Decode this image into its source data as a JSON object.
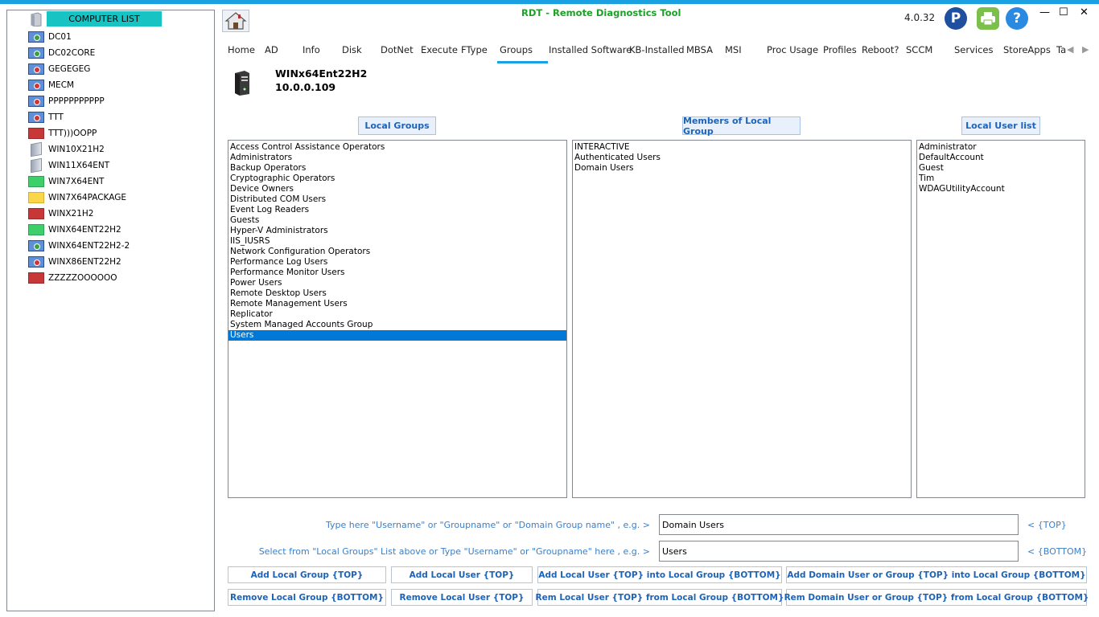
{
  "app": {
    "title": "RDT - Remote Diagnostics Tool",
    "version": "4.0.32",
    "minimize": "—",
    "maximize": "☐",
    "close": "✕",
    "paypal": "P",
    "help": "?"
  },
  "computer_list": {
    "header": "COMPUTER LIST",
    "items": [
      {
        "name": "DC01",
        "icon": "monitor-green"
      },
      {
        "name": "DC02CORE",
        "icon": "monitor-green"
      },
      {
        "name": "GEGEGEG",
        "icon": "monitor-red"
      },
      {
        "name": "MECM",
        "icon": "monitor-red"
      },
      {
        "name": "PPPPPPPPPPP",
        "icon": "monitor-red"
      },
      {
        "name": "TTT",
        "icon": "monitor-red"
      },
      {
        "name": "TTT)))OOPP",
        "icon": "square-red"
      },
      {
        "name": "WIN10X21H2",
        "icon": "tower"
      },
      {
        "name": "WIN11X64ENT",
        "icon": "tower"
      },
      {
        "name": "WIN7X64ENT",
        "icon": "square-green"
      },
      {
        "name": "WIN7X64PACKAGE",
        "icon": "square-yellow"
      },
      {
        "name": "WINX21H2",
        "icon": "square-red"
      },
      {
        "name": "WINX64ENT22H2",
        "icon": "square-green"
      },
      {
        "name": "WINX64ENT22H2-2",
        "icon": "monitor-green"
      },
      {
        "name": "WINX86ENT22H2",
        "icon": "monitor-red"
      },
      {
        "name": "ZZZZZOOOOOO",
        "icon": "square-red"
      }
    ]
  },
  "tabs": [
    "Home",
    "AD",
    "Info",
    "Disk",
    "DotNet",
    "Execute",
    "FType",
    "Groups",
    "Installed Software",
    "KB-Installed",
    "MBSA",
    "MSI",
    "Proc Usage",
    "Profiles",
    "Reboot?",
    "SCCM",
    "Services",
    "StoreApps",
    "Ta"
  ],
  "active_tab": "Groups",
  "host": {
    "name": "WINx64Ent22H2",
    "ip": "10.0.0.109"
  },
  "columns": {
    "local_groups_label": "Local Groups",
    "members_label": "Members of Local Group",
    "local_users_label": "Local User list"
  },
  "local_groups": [
    "Access Control Assistance Operators",
    "Administrators",
    "Backup Operators",
    "Cryptographic Operators",
    "Device Owners",
    "Distributed COM Users",
    "Event Log Readers",
    "Guests",
    "Hyper-V Administrators",
    "IIS_IUSRS",
    "Network Configuration Operators",
    "Performance Log Users",
    "Performance Monitor Users",
    "Power Users",
    "Remote Desktop Users",
    "Remote Management Users",
    "Replicator",
    "System Managed Accounts Group",
    "Users"
  ],
  "selected_group": "Users",
  "members": [
    "INTERACTIVE",
    "Authenticated Users",
    "Domain Users"
  ],
  "local_users": [
    "Administrator",
    "DefaultAccount",
    "Guest",
    "Tim",
    "WDAGUtilityAccount"
  ],
  "inputs": {
    "top_hint": "Type here \"Username\" or \"Groupname\" or \"Domain Group name\" , e.g. >",
    "top_value": "Domain Users",
    "top_tag": "< {TOP}",
    "bottom_hint": "Select from \"Local Groups\" List above or Type \"Username\" or \"Groupname\" here  , e.g. >",
    "bottom_value": "Users",
    "bottom_tag": "< {BOTTOM}"
  },
  "actions": {
    "add_local_group": "Add Local Group {TOP}",
    "add_local_user": "Add Local User {TOP}",
    "add_user_into_group": "Add Local User {TOP} into Local Group {BOTTOM}",
    "add_domain_into_group": "Add Domain User or Group {TOP} into Local Group {BOTTOM}",
    "remove_local_group": "Remove Local Group {BOTTOM}",
    "remove_local_user": "Remove Local User {TOP}",
    "rem_user_from_group": "Rem Local User {TOP} from Local Group {BOTTOM}",
    "rem_domain_from_group": "Rem Domain User or Group {TOP} from Local Group {BOTTOM}"
  },
  "colors": {
    "accent": "#1ba1e2",
    "title_green": "#1ea028",
    "link_blue": "#1d63b8",
    "selection": "#0078d7",
    "list_header_teal": "#17c3c3"
  }
}
